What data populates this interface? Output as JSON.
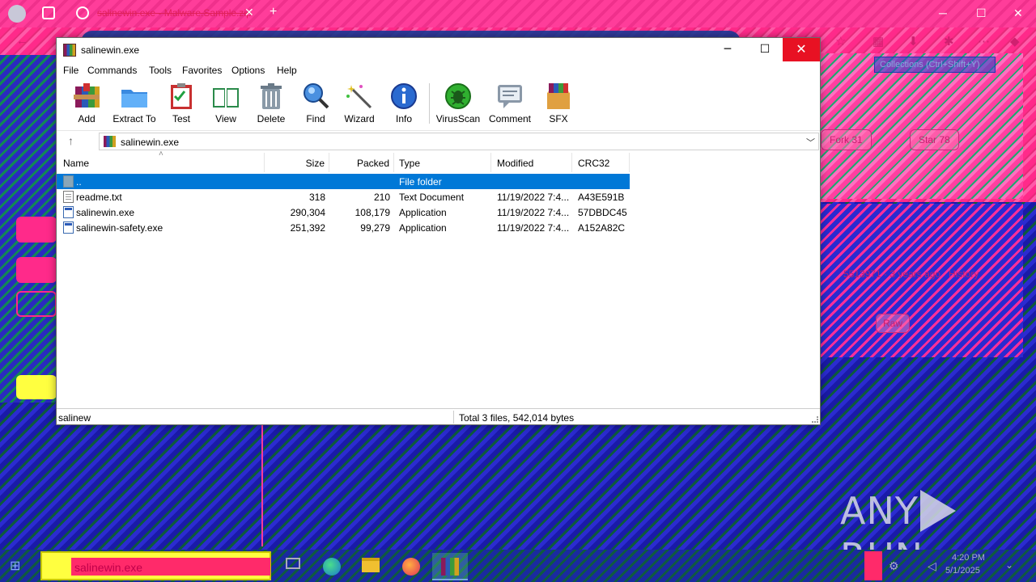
{
  "window": {
    "title": "salinewin.exe",
    "minimize": "─",
    "maximize": "☐",
    "close": "✕"
  },
  "menu": [
    "File",
    "Commands",
    "Tools",
    "Favorites",
    "Options",
    "Help"
  ],
  "toolbar": {
    "add": "Add",
    "extract": "Extract To",
    "test": "Test",
    "view": "View",
    "delete": "Delete",
    "find": "Find",
    "wizard": "Wizard",
    "info": "Info",
    "virusscan": "VirusScan",
    "comment": "Comment",
    "sfx": "SFX"
  },
  "address": {
    "path": "salinewin.exe"
  },
  "columns": [
    "Name",
    "Size",
    "Packed",
    "Type",
    "Modified",
    "CRC32"
  ],
  "files": [
    {
      "name": "..",
      "size": "",
      "packed": "",
      "type": "File folder",
      "modified": "",
      "crc": "",
      "icon": "folder-icon"
    },
    {
      "name": "readme.txt",
      "size": "318",
      "packed": "210",
      "type": "Text Document",
      "modified": "11/19/2022 7:4...",
      "crc": "A43E591B",
      "icon": "text-file-icon"
    },
    {
      "name": "salinewin.exe",
      "size": "290,304",
      "packed": "108,179",
      "type": "Application",
      "modified": "11/19/2022 7:4...",
      "crc": "57DBDC45",
      "icon": "exe-file-icon"
    },
    {
      "name": "salinewin-safety.exe",
      "size": "251,392",
      "packed": "99,279",
      "type": "Application",
      "modified": "11/19/2022 7:4...",
      "crc": "A152A82C",
      "icon": "exe-file-icon"
    }
  ],
  "status": {
    "left": "salinew",
    "right": "Total 3 files, 542,014 bytes"
  },
  "background": {
    "tab_title": "salinewin.exe - Malware.Sample.zip",
    "collections": "Collections (Ctrl+Shift+Y)",
    "fork": "Fork",
    "fork_count": "31",
    "star": "Star",
    "star_count": "78",
    "commit": "5513971 · 3 years ago",
    "history": "History",
    "raw": "Raw",
    "watermark": "ANY RUN"
  },
  "taskbar": {
    "search_text": "salinewin.exe",
    "time": "4:20 PM",
    "date": "5/1/2025"
  },
  "colors": {
    "selection": "#0078d7",
    "close_red": "#e81123"
  }
}
